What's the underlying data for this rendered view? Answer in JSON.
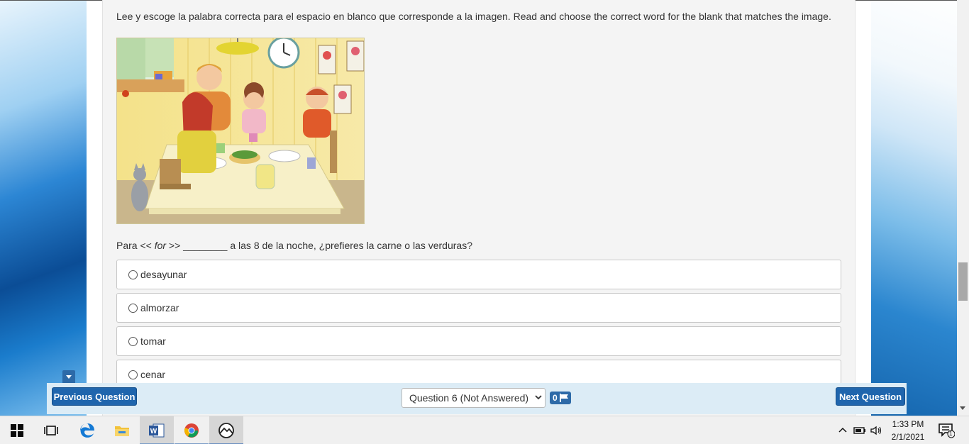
{
  "quiz": {
    "instructions": "Lee y escoge la palabra correcta para el espacio en blanco que corresponde a la imagen. Read and choose the correct word for the blank that matches the image.",
    "question_prefix": "Para << ",
    "question_hint": "for",
    "question_suffix": " >> ________ a las 8 de la noche, ¿prefieres la carne o las verduras?",
    "options": [
      {
        "label": "desayunar"
      },
      {
        "label": "almorzar"
      },
      {
        "label": "tomar"
      },
      {
        "label": "cenar"
      }
    ]
  },
  "nav": {
    "previous_label": "Previous Question",
    "next_label": "Next Question",
    "question_select_value": "Question 6 (Not Answered)",
    "flag_count": "0"
  },
  "taskbar": {
    "items": [
      "windows-start",
      "task-view",
      "edge",
      "file-explorer",
      "word",
      "chrome",
      "photos"
    ],
    "time": "1:33 PM",
    "date": "2/1/2021",
    "notification_count": "1"
  }
}
